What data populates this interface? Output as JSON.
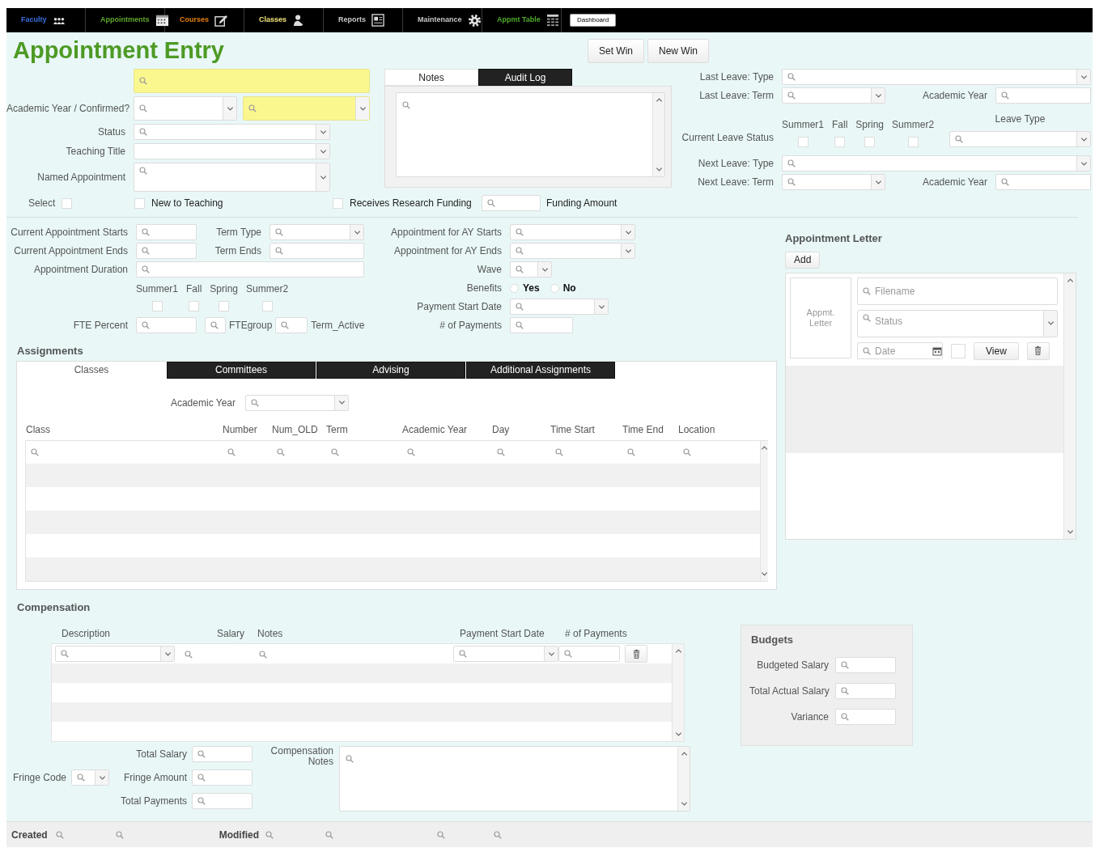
{
  "nav": {
    "items": [
      {
        "label": "Faculty",
        "color": "#3a6fe0"
      },
      {
        "label": "Appointments",
        "color": "#5fa82e"
      },
      {
        "label": "Courses",
        "color": "#e8800c"
      },
      {
        "label": "Classes",
        "color": "#f4e77a"
      },
      {
        "label": "Reports",
        "color": "#c8c8c8"
      },
      {
        "label": "Maintenance",
        "color": "#c8c8c8"
      },
      {
        "label": "Appmt Table",
        "color": "#4faa2a"
      }
    ],
    "dashboard": "Dashboard"
  },
  "title": "Appointment Entry",
  "window_buttons": [
    "Set Win",
    "New Win"
  ],
  "top_left": {
    "key_field": {
      "kind": "highlighted"
    },
    "rows": [
      {
        "label": "Academic Year / Confirmed?",
        "fields": [
          {
            "kind": "dropdown"
          },
          {
            "kind": "highlighted-dropdown"
          }
        ]
      },
      {
        "label": "Status",
        "fields": [
          {
            "kind": "dropdown"
          }
        ]
      },
      {
        "label": "Teaching Title",
        "fields": [
          {
            "kind": "plain-dropdown"
          }
        ]
      },
      {
        "label": "Named Appointment",
        "fields": [
          {
            "kind": "tall-dropdown"
          }
        ]
      }
    ]
  },
  "notes_panel": {
    "tabs": [
      {
        "label": "Notes",
        "selected": true
      },
      {
        "label": "Audit Log",
        "selected": false
      }
    ],
    "field": {
      "kind": "textarea"
    }
  },
  "leave": [
    {
      "kind": "type",
      "label": "Last Leave: Type",
      "field": {
        "kind": "dropdown"
      }
    },
    {
      "kind": "term",
      "label": "Last Leave: Term",
      "field": {
        "kind": "dropdown"
      },
      "year_label": "Academic Year",
      "year_field": {
        "kind": "search"
      }
    },
    {
      "kind": "status",
      "label": "Current Leave Status",
      "terms": [
        {
          "label": "Summer1",
          "checked": false
        },
        {
          "label": "Fall",
          "checked": false
        },
        {
          "label": "Spring",
          "checked": false
        },
        {
          "label": "Summer2",
          "checked": false
        }
      ],
      "type_label": "Leave Type",
      "type_field": {
        "kind": "dropdown"
      }
    },
    {
      "kind": "type",
      "label": "Next Leave: Type",
      "field": {
        "kind": "dropdown"
      }
    },
    {
      "kind": "term",
      "label": "Next Leave: Term",
      "field": {
        "kind": "dropdown"
      },
      "year_label": "Academic Year",
      "year_field": {
        "kind": "search"
      }
    }
  ],
  "flags": {
    "checks": [
      {
        "label": "Select",
        "checked": false
      },
      {
        "label": "New to Teaching",
        "checked": false
      },
      {
        "label": "Receives Research Funding",
        "checked": false
      }
    ],
    "funding_field": {
      "kind": "search"
    },
    "funding_label": "Funding Amount"
  },
  "appointment": {
    "current_starts": {
      "label": "Current Appointment Starts",
      "field": {
        "kind": "search"
      }
    },
    "term_type": {
      "label": "Term Type",
      "field": {
        "kind": "dropdown"
      }
    },
    "ay_starts": {
      "label": "Appointment for AY Starts",
      "field": {
        "kind": "dropdown"
      }
    },
    "current_ends": {
      "label": "Current Appointment Ends",
      "field": {
        "kind": "search"
      }
    },
    "term_ends": {
      "label": "Term Ends",
      "field": {
        "kind": "search"
      }
    },
    "ay_ends": {
      "label": "Appointment for AY Ends",
      "field": {
        "kind": "dropdown"
      }
    },
    "duration": {
      "label": "Appointment Duration",
      "field": {
        "kind": "search"
      }
    },
    "wave": {
      "label": "Wave",
      "field": {
        "kind": "dropdown"
      }
    },
    "terms": [
      {
        "label": "Summer1",
        "checked": false
      },
      {
        "label": "Fall",
        "checked": false
      },
      {
        "label": "Spring",
        "checked": false
      },
      {
        "label": "Summer2",
        "checked": false
      }
    ],
    "benefits": {
      "label": "Benefits",
      "options": [
        {
          "label": "Yes",
          "selected": false
        },
        {
          "label": "No",
          "selected": false
        }
      ]
    },
    "payment_start": {
      "label": "Payment Start Date",
      "field": {
        "kind": "dropdown"
      }
    },
    "fte_percent": {
      "label": "FTE Percent",
      "field": {
        "kind": "search"
      }
    },
    "fte_group": {
      "pre_field": {
        "kind": "search"
      },
      "label": "FTEgroup",
      "field": {
        "kind": "search"
      }
    },
    "term_active": {
      "label": "Term_Active"
    },
    "payments": {
      "label": "# of Payments",
      "field": {
        "kind": "search"
      }
    }
  },
  "letter": {
    "title": "Appointment Letter",
    "add": "Add",
    "thumb_label": "Appmt. Letter",
    "filename": {
      "kind": "search",
      "placeholder": "Filename"
    },
    "status": {
      "kind": "tall-dropdown",
      "placeholder": "Status"
    },
    "date": {
      "kind": "date",
      "placeholder": "Date"
    },
    "checked": false,
    "view": "View"
  },
  "assignments": {
    "title": "Assignments",
    "tabs": [
      {
        "label": "Classes",
        "selected": true
      },
      {
        "label": "Committees",
        "selected": false
      },
      {
        "label": "Advising",
        "selected": false
      },
      {
        "label": "Additional Assignments",
        "selected": false
      }
    ],
    "year_label": "Academic Year",
    "year_field": {
      "kind": "dropdown"
    },
    "columns": [
      "Class",
      "Number",
      "Num_OLD",
      "Term",
      "Academic Year",
      "Day",
      "Time Start",
      "Time End",
      "Location"
    ],
    "filters": [
      {
        "kind": "bare"
      },
      {
        "kind": "bare"
      },
      {
        "kind": "bare"
      },
      {
        "kind": "bare"
      },
      {
        "kind": "bare"
      },
      {
        "kind": "bare"
      },
      {
        "kind": "bare"
      },
      {
        "kind": "bare"
      },
      {
        "kind": "bare"
      }
    ]
  },
  "compensation": {
    "title": "Compensation",
    "columns": [
      "Description",
      "Salary",
      "Notes",
      "Payment Start Date",
      "# of Payments"
    ],
    "entry": [
      {
        "kind": "dropdown"
      },
      {
        "kind": "bare"
      },
      {
        "kind": "bare"
      },
      {
        "kind": "dropdown"
      },
      {
        "kind": "search"
      }
    ],
    "total_salary": {
      "label": "Total Salary",
      "field": {
        "kind": "search"
      }
    },
    "fringe_code": {
      "label": "Fringe Code",
      "field": {
        "kind": "dropdown"
      }
    },
    "fringe_amount": {
      "label": "Fringe Amount",
      "field": {
        "kind": "search"
      }
    },
    "total_payments": {
      "label": "Total Payments",
      "field": {
        "kind": "search"
      }
    },
    "notes": {
      "label": "Compensation Notes",
      "field": {
        "kind": "textarea"
      }
    }
  },
  "budgets": {
    "title": "Budgets",
    "rows": [
      {
        "label": "Budgeted Salary",
        "field": {
          "kind": "search"
        }
      },
      {
        "label": "Total Actual Salary",
        "field": {
          "kind": "search"
        }
      },
      {
        "label": "Variance",
        "field": {
          "kind": "search"
        }
      }
    ]
  },
  "footer": {
    "created_label": "Created",
    "created_fields": [
      {
        "kind": "bare"
      },
      {
        "kind": "bare"
      }
    ],
    "modified_label": "Modified",
    "modified_fields": [
      {
        "kind": "bare"
      },
      {
        "kind": "bare"
      },
      {
        "kind": "bare"
      },
      {
        "kind": "bare"
      }
    ]
  }
}
